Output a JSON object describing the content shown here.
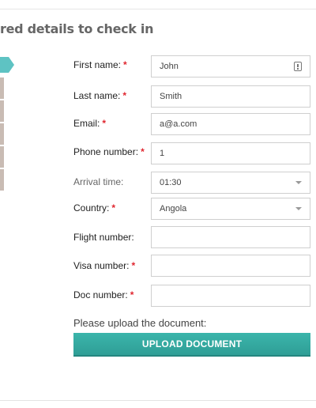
{
  "heading": "red details to check in",
  "form": {
    "first_name": {
      "label": "First name:",
      "required": "*",
      "value": "John"
    },
    "last_name": {
      "label": "Last name:",
      "required": "*",
      "value": "Smith"
    },
    "email": {
      "label": "Email:",
      "required": "*",
      "value": "a@a.com"
    },
    "phone": {
      "label": "Phone number:",
      "required": "*",
      "value": "1"
    },
    "arrival_time": {
      "label": "Arrival time:",
      "value": "01:30"
    },
    "country": {
      "label": "Country:",
      "required": "*",
      "value": "Angola"
    },
    "flight_number": {
      "label": "Flight number:",
      "value": ""
    },
    "visa_number": {
      "label": "Visa number:",
      "required": "*",
      "value": ""
    },
    "doc_number": {
      "label": "Doc number:",
      "required": "*",
      "value": ""
    }
  },
  "upload": {
    "prompt": "Please upload the document:",
    "button": "UPLOAD DOCUMENT"
  },
  "colors": {
    "accent": "#3bb5ab",
    "step_active": "#5ec3c3",
    "step_inactive": "#c9bcb4",
    "required": "#e0262f"
  },
  "icons": {
    "first_name_field": "contact-card-icon",
    "dropdowns": "chevron-down-icon"
  }
}
